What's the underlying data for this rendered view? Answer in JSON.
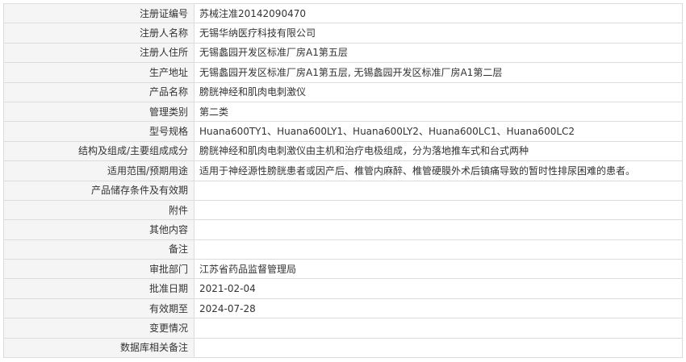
{
  "rows": [
    {
      "label": "注册证编号",
      "value": "苏械注准20142090470"
    },
    {
      "label": "注册人名称",
      "value": "无锡华纳医疗科技有限公司"
    },
    {
      "label": "注册人住所",
      "value": "无锡蠡园开发区标准厂房A1第五层"
    },
    {
      "label": "生产地址",
      "value": "无锡蠡园开发区标准厂房A1第五层, 无锡蠡园开发区标准厂房A1第二层"
    },
    {
      "label": "产品名称",
      "value": "膀胱神经和肌肉电刺激仪"
    },
    {
      "label": "管理类别",
      "value": "第二类"
    },
    {
      "label": "型号规格",
      "value": "Huana600TY1、Huana600LY1、Huana600LY2、Huana600LC1、Huana600LC2"
    },
    {
      "label": "结构及组成/主要组成成分",
      "value": "膀胱神经和肌肉电刺激仪由主机和治疗电极组成，分为落地推车式和台式两种"
    },
    {
      "label": "适用范围/预期用途",
      "value": "适用于神经源性膀胱患者或因产后、椎管内麻醉、椎管硬膜外术后镇痛导致的暂时性排尿困难的患者。"
    },
    {
      "label": "产品储存条件及有效期",
      "value": ""
    },
    {
      "label": "附件",
      "value": ""
    },
    {
      "label": "其他内容",
      "value": ""
    },
    {
      "label": "备注",
      "value": ""
    },
    {
      "label": "审批部门",
      "value": "江苏省药品监督管理局"
    },
    {
      "label": "批准日期",
      "value": "2021-02-04"
    },
    {
      "label": "有效期至",
      "value": "2024-07-28"
    },
    {
      "label": "变更情况",
      "value": ""
    },
    {
      "label": "数据库相关备注",
      "value": ""
    }
  ]
}
